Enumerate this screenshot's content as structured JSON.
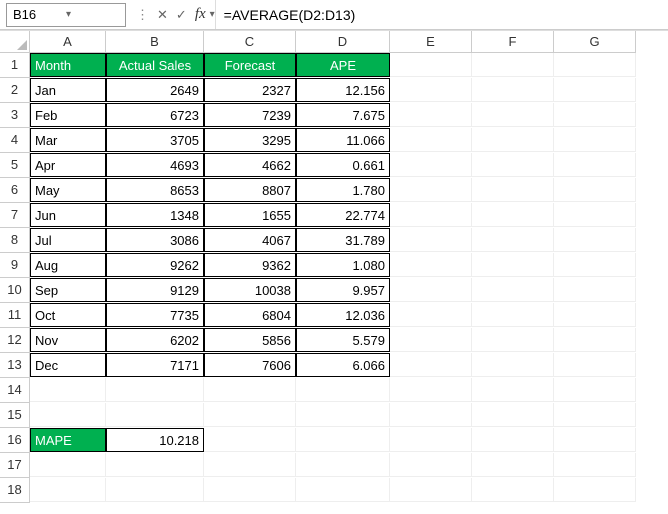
{
  "formula_bar": {
    "name_box": "B16",
    "formula": "=AVERAGE(D2:D13)"
  },
  "col_letters": [
    "A",
    "B",
    "C",
    "D",
    "E",
    "F",
    "G"
  ],
  "row_numbers": [
    1,
    2,
    3,
    4,
    5,
    6,
    7,
    8,
    9,
    10,
    11,
    12,
    13,
    14,
    15,
    16,
    17,
    18
  ],
  "headers": {
    "A": "Month",
    "B": "Actual Sales",
    "C": "Forecast",
    "D": "APE"
  },
  "rows": [
    {
      "month": "Jan",
      "actual": "2649",
      "forecast": "2327",
      "ape": "12.156"
    },
    {
      "month": "Feb",
      "actual": "6723",
      "forecast": "7239",
      "ape": "7.675"
    },
    {
      "month": "Mar",
      "actual": "3705",
      "forecast": "3295",
      "ape": "11.066"
    },
    {
      "month": "Apr",
      "actual": "4693",
      "forecast": "4662",
      "ape": "0.661"
    },
    {
      "month": "May",
      "actual": "8653",
      "forecast": "8807",
      "ape": "1.780"
    },
    {
      "month": "Jun",
      "actual": "1348",
      "forecast": "1655",
      "ape": "22.774"
    },
    {
      "month": "Jul",
      "actual": "3086",
      "forecast": "4067",
      "ape": "31.789"
    },
    {
      "month": "Aug",
      "actual": "9262",
      "forecast": "9362",
      "ape": "1.080"
    },
    {
      "month": "Sep",
      "actual": "9129",
      "forecast": "10038",
      "ape": "9.957"
    },
    {
      "month": "Oct",
      "actual": "7735",
      "forecast": "6804",
      "ape": "12.036"
    },
    {
      "month": "Nov",
      "actual": "6202",
      "forecast": "5856",
      "ape": "5.579"
    },
    {
      "month": "Dec",
      "actual": "7171",
      "forecast": "7606",
      "ape": "6.066"
    }
  ],
  "summary": {
    "label": "MAPE",
    "value": "10.218"
  }
}
